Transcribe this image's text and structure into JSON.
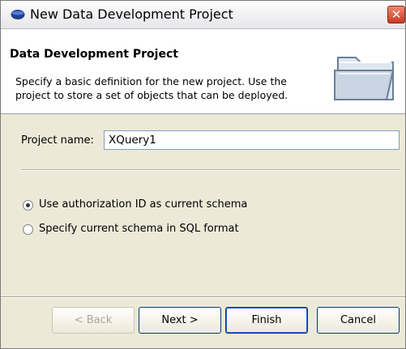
{
  "window": {
    "title": "New Data Development Project"
  },
  "banner": {
    "title": "Data Development Project",
    "description": "Specify a basic definition for the new project.  Use the project to store a set of objects that can be deployed."
  },
  "form": {
    "project_name_label": "Project name:",
    "project_name_value": "XQuery1"
  },
  "schema_options": [
    {
      "label": "Use authorization ID as current schema",
      "selected": true
    },
    {
      "label": "Specify current schema in SQL format",
      "selected": false
    }
  ],
  "buttons": {
    "back": "< Back",
    "next": "Next >",
    "finish": "Finish",
    "cancel": "Cancel"
  }
}
